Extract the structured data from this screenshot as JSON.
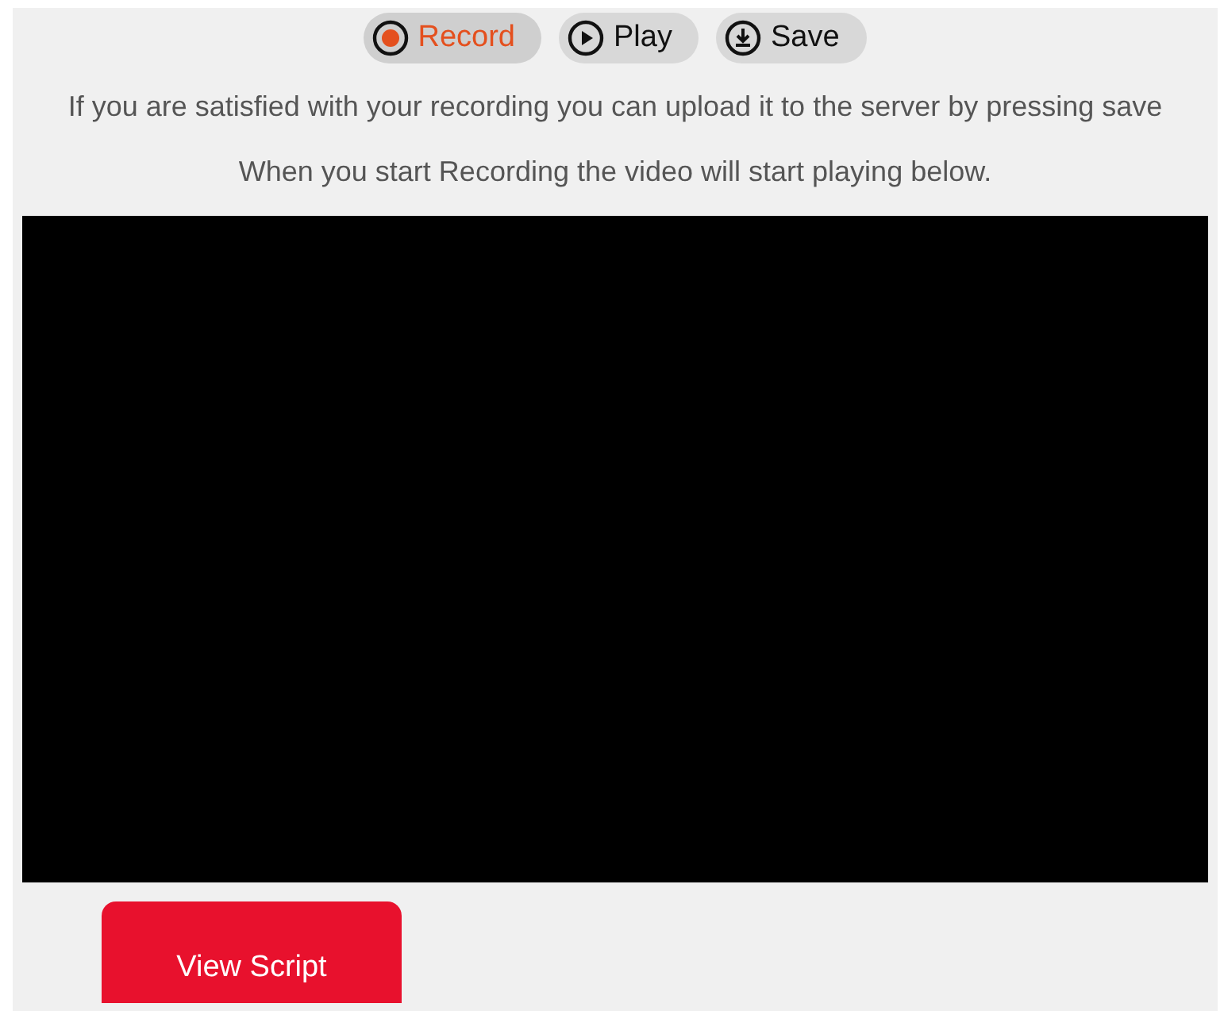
{
  "controls": [
    {
      "kind": "record",
      "label": "Record",
      "selected": true
    },
    {
      "kind": "play",
      "label": "Play",
      "selected": false
    },
    {
      "kind": "save",
      "label": "Save",
      "selected": false
    }
  ],
  "instructions": [
    "If you are satisfied with your recording you can upload it to the server by pressing save",
    "When you start Recording the video will start playing below."
  ],
  "video": {
    "kind": "empty"
  },
  "script_button": {
    "label": "View Script"
  }
}
